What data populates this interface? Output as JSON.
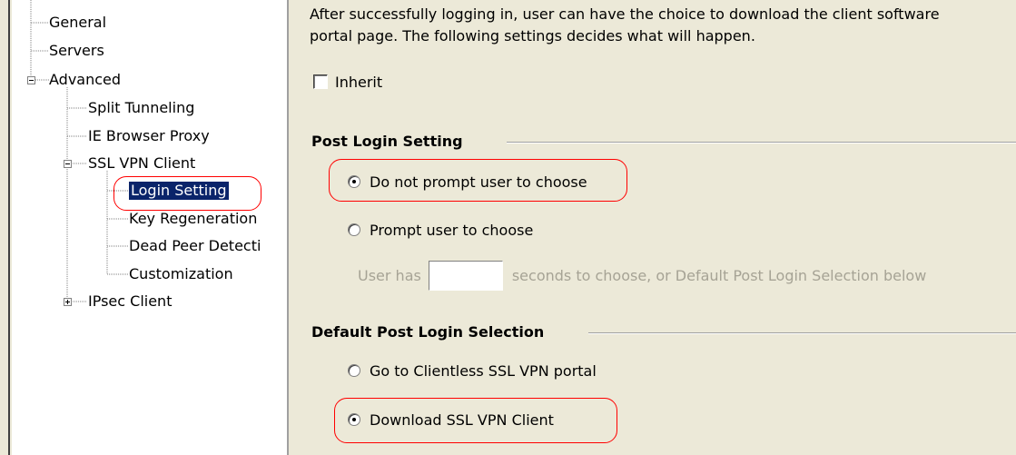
{
  "tree": {
    "items": [
      {
        "label": "General",
        "expander": ""
      },
      {
        "label": "Servers",
        "expander": ""
      },
      {
        "label": "Advanced",
        "expander": "minus"
      },
      {
        "label": "Split Tunneling",
        "expander": ""
      },
      {
        "label": "IE Browser Proxy",
        "expander": ""
      },
      {
        "label": "SSL VPN Client",
        "expander": "minus"
      },
      {
        "label": "Login Setting",
        "expander": "",
        "selected": true
      },
      {
        "label": "Key Regeneration",
        "expander": ""
      },
      {
        "label": "Dead Peer Detecti",
        "expander": ""
      },
      {
        "label": "Customization",
        "expander": ""
      },
      {
        "label": "IPsec Client",
        "expander": "plus"
      }
    ]
  },
  "main": {
    "description_line1": "After successfully logging in, user can have the choice to download the client software",
    "description_line2": "portal page. The following settings decides what will happen.",
    "inherit_label": "Inherit",
    "inherit_checked": false,
    "post_login": {
      "title": "Post Login Setting",
      "option_no_prompt": "Do not prompt user to choose",
      "option_prompt": "Prompt user to choose",
      "selected": "no_prompt",
      "seconds_prefix": "User has",
      "seconds_value": "",
      "seconds_suffix": "seconds to choose, or Default Post Login Selection below"
    },
    "default_selection": {
      "title": "Default Post Login Selection",
      "option_clientless": "Go to Clientless SSL VPN portal",
      "option_download": "Download SSL VPN Client",
      "selected": "download"
    }
  },
  "colors": {
    "selection_bg": "#0a246a",
    "highlight": "#ff0000",
    "window_bg": "#ece9d8",
    "disabled_text": "#a6a395"
  }
}
